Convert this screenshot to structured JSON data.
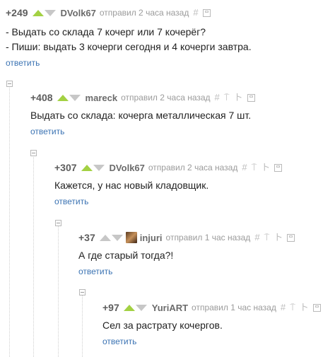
{
  "reply_label": "ответить",
  "comments": [
    {
      "rating": "+249",
      "author": "DVolk67",
      "meta": "отправил 2 часа назад",
      "lines": [
        "- Выдать со склада 7 кочерг или 7 кочерёг?",
        "- Пиши: выдать 3 кочерги сегодня и 4 кочерги завтра."
      ]
    },
    {
      "rating": "+408",
      "author": "mareck",
      "meta": "отправил 2 часа назад",
      "lines": [
        "Выдать со склада: кочерга металлическая 7 шт."
      ]
    },
    {
      "rating": "+307",
      "author": "DVolk67",
      "meta": "отправил 2 часа назад",
      "lines": [
        "Кажется, у нас новый кладовщик."
      ]
    },
    {
      "rating": "+37",
      "author": "injuri",
      "meta": "отправил 1 час назад",
      "lines": [
        "А где старый тогда?!"
      ]
    },
    {
      "rating": "+97",
      "author": "YuriART",
      "meta": "отправил 1 час назад",
      "lines": [
        "Сел за растрату кочергов."
      ]
    }
  ],
  "icons": {
    "link": "#",
    "parent": "⍑",
    "branch": "ト",
    "save": "save-icon"
  },
  "colors": {
    "upvote": "#a3d143",
    "downvote": "#c7c7c7",
    "link": "#3b73b3"
  }
}
